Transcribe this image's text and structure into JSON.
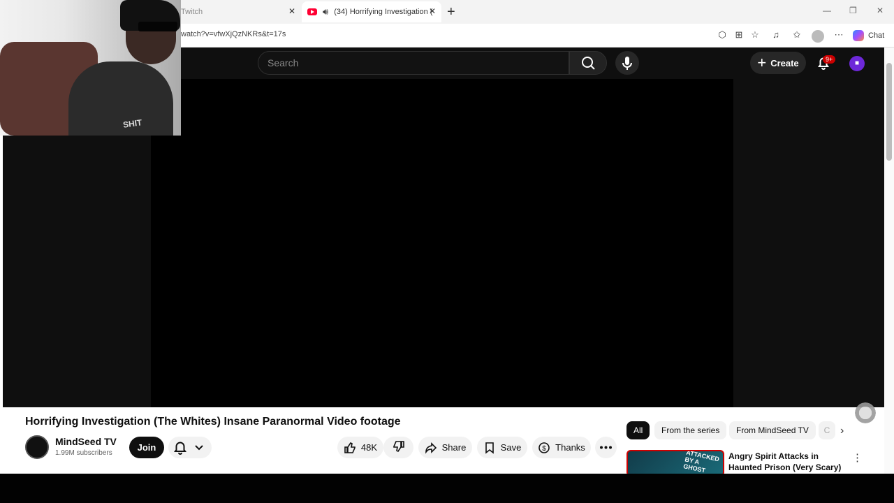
{
  "browser": {
    "tabs": [
      {
        "label": "Twitch"
      },
      {
        "label": "(34) Horrifying Investigation ("
      }
    ],
    "url": "watch?v=vfwXjQzNKRs&t=17s",
    "chat_label": "Chat"
  },
  "masthead": {
    "search_placeholder": "Search",
    "create_label": "Create",
    "notification_count": "9+"
  },
  "video": {
    "title": "Horrifying Investigation (The Whites) Insane Paranormal Video footage",
    "channel": "MindSeed TV",
    "subscribers": "1.99M subscribers",
    "join_label": "Join",
    "likes": "48K",
    "actions": {
      "share": "Share",
      "save": "Save",
      "thanks": "Thanks"
    }
  },
  "recommendations": {
    "chips": [
      {
        "label": "All"
      },
      {
        "label": "From the series"
      },
      {
        "label": "From MindSeed TV"
      },
      {
        "label": "C"
      }
    ],
    "items": [
      {
        "title": "Angry Spirit Attacks in Haunted Prison (Very Scary) Unexplain...",
        "thumbnail_text": "ATTACKED BY A GHOST"
      }
    ]
  },
  "webcam": {
    "shirt_text": "SHIT"
  },
  "colors": {
    "youtube_red": "#ff0033",
    "dark_bg": "#0f0f0f",
    "accent_purple": "#6d28d9"
  }
}
